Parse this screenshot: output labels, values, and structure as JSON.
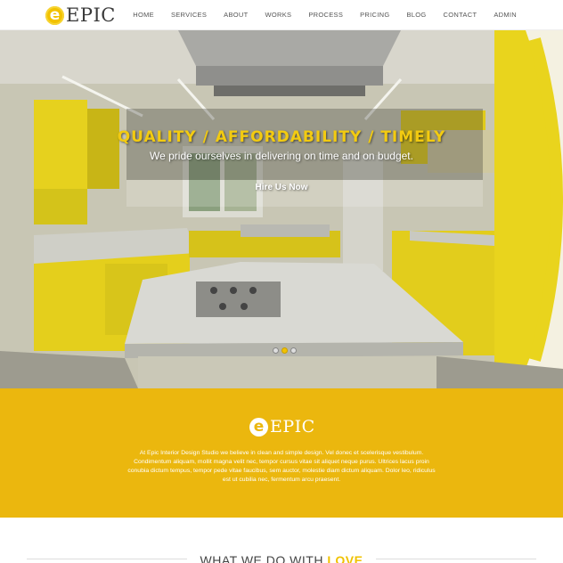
{
  "header": {
    "logo_letter": "e",
    "logo_text": "EPIC",
    "nav": [
      "HOME",
      "SERVICES",
      "ABOUT",
      "WORKS",
      "PROCESS",
      "PRICING",
      "BLOG",
      "CONTACT",
      "ADMIN"
    ]
  },
  "hero": {
    "title": "QUALITY / AFFORDABILITY / TIMELY",
    "subtitle": "We pride ourselves in delivering on time and on budget.",
    "cta_label": "Hire Us Now",
    "slides": 3,
    "active_slide": 2
  },
  "band": {
    "logo_letter": "e",
    "logo_text": "EPIC",
    "text": "At Epic Interior Design Studio we believe in clean and simple design. Vel donec et scelerisque vestibulum. Condimentum aliquam, mollit magna velit nec, tempor cursus vitae sit aliquet neque purus. Ultrices lacus proin conubia dictum tempus, tempor pede vitae faucibus, sem auctor, molestie diam dictum aliquam. Dolor leo, ridiculus est ut cubilia nec, fermentum arcu praesent."
  },
  "section": {
    "title_prefix": "WHAT WE DO WITH ",
    "title_highlight": "LOVE"
  },
  "colors": {
    "accent": "#ebb70e",
    "hero_title": "#f3cb10",
    "cabinet_yellow": "#e8d21c"
  }
}
